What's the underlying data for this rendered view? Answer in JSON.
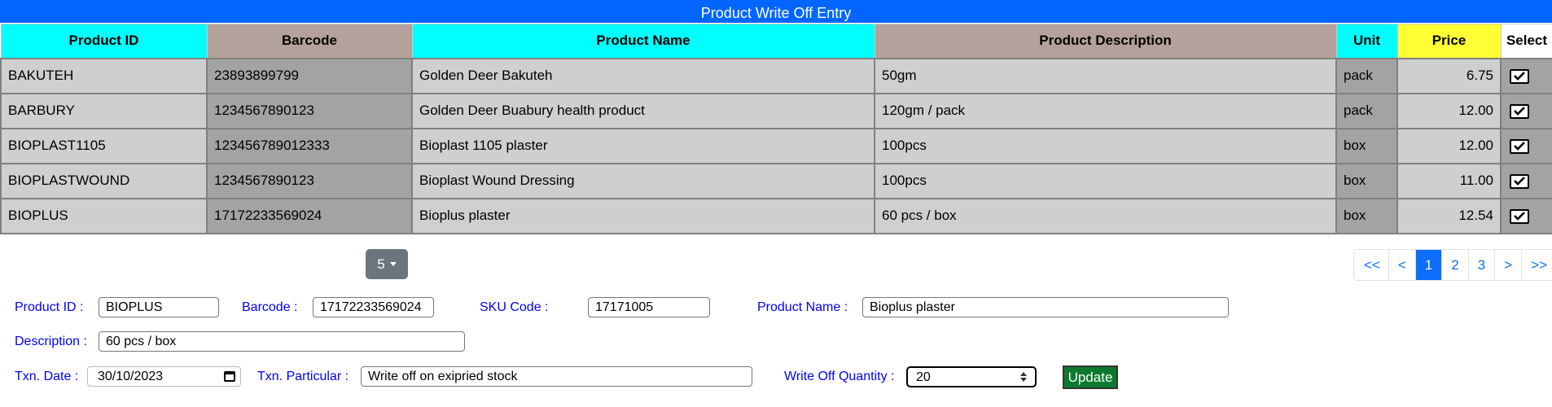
{
  "window": {
    "title": "Product Write Off Entry"
  },
  "table": {
    "columns": [
      {
        "label": "Product ID",
        "bg": "#00ffff"
      },
      {
        "label": "Barcode",
        "bg": "#b5a19b"
      },
      {
        "label": "Product Name",
        "bg": "#00ffff"
      },
      {
        "label": "Product Description",
        "bg": "#b5a19b"
      },
      {
        "label": "Unit",
        "bg": "#00ffff"
      },
      {
        "label": "Price",
        "bg": "#ffff33"
      },
      {
        "label": "Select",
        "bg": "#ffffff"
      }
    ],
    "rows": [
      {
        "id": "BAKUTEH",
        "barcode": "23893899799",
        "name": "Golden Deer Bakuteh",
        "desc": "50gm",
        "unit": "pack",
        "price": "6.75"
      },
      {
        "id": "BARBURY",
        "barcode": "1234567890123",
        "name": "Golden Deer Buabury health product",
        "desc": "120gm / pack",
        "unit": "pack",
        "price": "12.00"
      },
      {
        "id": "BIOPLAST1105",
        "barcode": "123456789012333",
        "name": "Bioplast 1105 plaster",
        "desc": "100pcs",
        "unit": "box",
        "price": "12.00"
      },
      {
        "id": "BIOPLASTWOUND",
        "barcode": "1234567890123",
        "name": "Bioplast Wound Dressing",
        "desc": "100pcs",
        "unit": "box",
        "price": "11.00"
      },
      {
        "id": "BIOPLUS",
        "barcode": "17172233569024",
        "name": "Bioplus plaster",
        "desc": "60 pcs / box",
        "unit": "box",
        "price": "12.54"
      }
    ]
  },
  "pagesize": {
    "value": "5"
  },
  "pager": {
    "first": "<<",
    "prev": "<",
    "pages": [
      "1",
      "2",
      "3"
    ],
    "active": "1",
    "next": ">",
    "last": ">>"
  },
  "form": {
    "product_id": {
      "label": "Product ID :",
      "value": "BIOPLUS"
    },
    "barcode": {
      "label": "Barcode :",
      "value": "17172233569024"
    },
    "sku": {
      "label": "SKU Code :",
      "value": "17171005"
    },
    "product_name": {
      "label": "Product Name :",
      "value": "Bioplus plaster"
    },
    "description": {
      "label": "Description :",
      "value": "60 pcs / box"
    },
    "txn_date": {
      "label": "Txn. Date :",
      "value": "30/10/2023"
    },
    "txn_particular": {
      "label": "Txn. Particular :",
      "value": "Write off on exipried stock"
    },
    "write_off_qty": {
      "label": "Write Off Quantity :",
      "value": "20"
    },
    "update_label": "Update"
  },
  "colors": {
    "title_bar": "#0066ff",
    "accent": "#0d6efd",
    "update": "#0b7a2e",
    "label": "#0000ee"
  }
}
